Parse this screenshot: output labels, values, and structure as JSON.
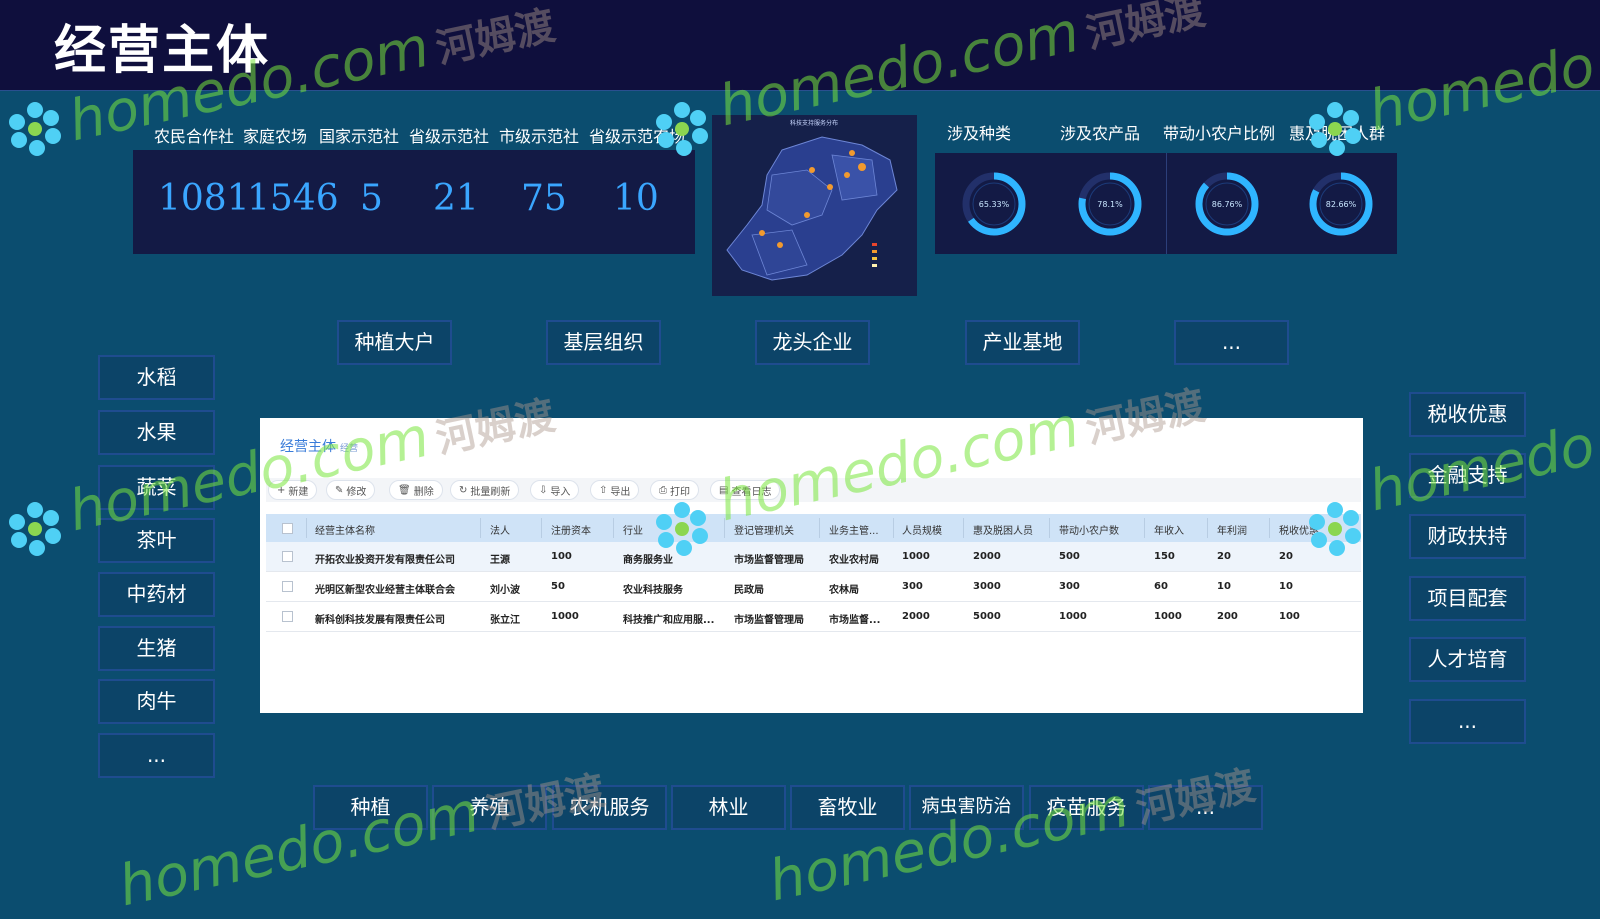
{
  "header": {
    "title": "经营主体"
  },
  "stats": {
    "labels": [
      "农民合作社",
      "家庭农场",
      "国家示范社",
      "省级示范社",
      "市级示范社",
      "省级示范农场"
    ],
    "values": [
      "1081",
      "1546",
      "5",
      "21",
      "75",
      "10"
    ]
  },
  "map": {
    "title": "科技支持服务分布"
  },
  "donuts": {
    "labels": [
      "涉及种类",
      "涉及农产品",
      "带动小农户比例",
      "惠及脱困人群"
    ],
    "values": [
      "65.33%",
      "78.1%",
      "86.76%",
      "82.66%"
    ],
    "fractions": [
      0.6533,
      0.781,
      0.8676,
      0.8266
    ]
  },
  "top_buttons": [
    "种植大户",
    "基层组织",
    "龙头企业",
    "产业基地",
    "..."
  ],
  "left_buttons": [
    "水稻",
    "水果",
    "蔬菜",
    "茶叶",
    "中药材",
    "生猪",
    "肉牛",
    "..."
  ],
  "right_buttons": [
    "税收优惠",
    "金融支持",
    "财政扶持",
    "项目配套",
    "人才培育",
    "..."
  ],
  "bottom_buttons": [
    "种植",
    "养殖",
    "农机服务",
    "林业",
    "畜牧业",
    "病虫害防治",
    "疫苗服务",
    "..."
  ],
  "table": {
    "title": "经营主体",
    "subtitle": "经营",
    "toolbar": [
      {
        "icon": "+",
        "label": "新建"
      },
      {
        "icon": "✎",
        "label": "修改"
      },
      {
        "icon": "🗑",
        "label": "删除"
      },
      {
        "icon": "↻",
        "label": "批量刷新"
      },
      {
        "icon": "⇩",
        "label": "导入"
      },
      {
        "icon": "⇧",
        "label": "导出"
      },
      {
        "icon": "⎙",
        "label": "打印"
      },
      {
        "icon": "▤",
        "label": "查看日志"
      }
    ],
    "columns": [
      "经营主体名称",
      "法人",
      "注册资本",
      "行业",
      "登记管理机关",
      "业务主管...",
      "人员规模",
      "惠及脱困人员",
      "带动小农户数",
      "年收入",
      "年利润",
      "税收优惠"
    ],
    "rows": [
      [
        "开拓农业投资开发有限责任公司",
        "王源",
        "100",
        "商务服务业",
        "市场监督管理局",
        "农业农村局",
        "1000",
        "2000",
        "500",
        "150",
        "20",
        "20"
      ],
      [
        "光明区新型农业经营主体联合会",
        "刘小波",
        "50",
        "农业科技服务",
        "民政局",
        "农林局",
        "300",
        "3000",
        "300",
        "60",
        "10",
        "10"
      ],
      [
        "新科创科技发展有限责任公司",
        "张立江",
        "1000",
        "科技推广和应用服...",
        "市场监督管理局",
        "市场监督...",
        "2000",
        "5000",
        "1000",
        "1000",
        "200",
        "100"
      ]
    ]
  },
  "watermark": {
    "text": "homedo.com",
    "cn": "河姆渡"
  }
}
